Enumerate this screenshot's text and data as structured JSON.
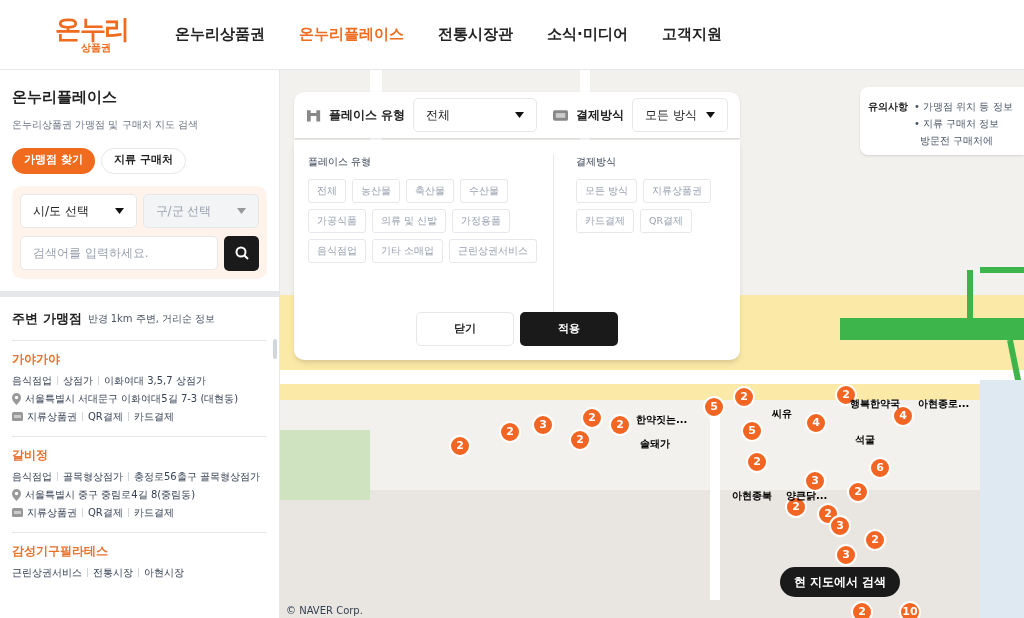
{
  "header": {
    "logo": {
      "main": "온누리",
      "sub": "상품권"
    },
    "nav": [
      {
        "label": "온누리상품권",
        "selected": false
      },
      {
        "label": "온누리플레이스",
        "selected": true
      },
      {
        "label": "전통시장관",
        "selected": false
      },
      {
        "label": "소식·미디어",
        "selected": false
      },
      {
        "label": "고객지원",
        "selected": false
      }
    ]
  },
  "sidebar": {
    "title": "온누리플레이스",
    "subtitle": "온누리상품권 가맹점 및 구매처 지도 검색",
    "tabs": [
      {
        "label": "가맹점 찾기",
        "selected": true
      },
      {
        "label": "지류 구매처",
        "selected": false
      }
    ],
    "region_select": {
      "value": "시/도 선택",
      "disabled": false
    },
    "district_select": {
      "value": "구/군 선택",
      "disabled": true
    },
    "search": {
      "placeholder": "검색어를 입력하세요."
    },
    "nearby": {
      "title": "주변 가맹점",
      "note": "반경 1km 주변, 거리순 정보"
    },
    "stores": [
      {
        "name": "가야가야",
        "tags": [
          "음식점업",
          "상점가",
          "이화여대 3,5,7 상점가"
        ],
        "address": "서울특별시 서대문구 이화여대5길 7-3 (대현동)",
        "payments": [
          "지류상품권",
          "QR결제",
          "카드결제"
        ]
      },
      {
        "name": "갈비정",
        "tags": [
          "음식점업",
          "골목형상점가",
          "충정로56출구 골목형상점가"
        ],
        "address": "서울특별시 중구 중림로4길 8(중림동)",
        "payments": [
          "지류상품권",
          "QR결제",
          "카드결제"
        ]
      },
      {
        "name": "감성기구필라테스",
        "tags": [
          "근린상권서비스",
          "전통시장",
          "아현시장"
        ]
      }
    ]
  },
  "map": {
    "filter_bar": {
      "place_type": {
        "label": "플레이스 유형",
        "value": "전체"
      },
      "payment": {
        "label": "결제방식",
        "value": "모든 방식"
      }
    },
    "filter_panel": {
      "place_type": {
        "title": "플레이스 유형",
        "options": [
          {
            "label": "전체",
            "selected": false
          },
          {
            "label": "농산물",
            "selected": false
          },
          {
            "label": "축산물",
            "selected": false
          },
          {
            "label": "수산물",
            "selected": false
          },
          {
            "label": "가공식품",
            "selected": false
          },
          {
            "label": "의류 및 신발",
            "selected": false
          },
          {
            "label": "가정용품",
            "selected": false
          },
          {
            "label": "음식점업",
            "selected": false
          },
          {
            "label": "기타 소매업",
            "selected": false
          },
          {
            "label": "근린상권서비스",
            "selected": false
          }
        ]
      },
      "payment": {
        "title": "결제방식",
        "options": [
          {
            "label": "모든 방식",
            "selected": false
          },
          {
            "label": "지류상품권",
            "selected": false
          },
          {
            "label": "카드결제",
            "selected": false
          },
          {
            "label": "QR결제",
            "selected": false
          }
        ]
      },
      "buttons": [
        {
          "label": "닫기",
          "kind": "secondary"
        },
        {
          "label": "적용",
          "kind": "primary"
        }
      ]
    },
    "notice": {
      "title": "유의사항",
      "lines": [
        "• 가맹점 위치 등 정보",
        "• 지류 구매처 정보",
        "방문전 구매처에"
      ]
    },
    "clusters": [
      "2",
      "2",
      "3",
      "2",
      "2",
      "2",
      "5",
      "2",
      "5",
      "4",
      "2",
      "4",
      "6",
      "2",
      "3",
      "2",
      "2",
      "2",
      "3",
      "2",
      "3",
      "2",
      "10"
    ],
    "labels": [
      "한약짓는...",
      "솔돼가",
      "씨유",
      "행복한약국",
      "아현종로...",
      "석굴",
      "아현종북",
      "양큰닭..."
    ],
    "search_here": "현 지도에서 검색",
    "attribution": "© NAVER Corp."
  }
}
